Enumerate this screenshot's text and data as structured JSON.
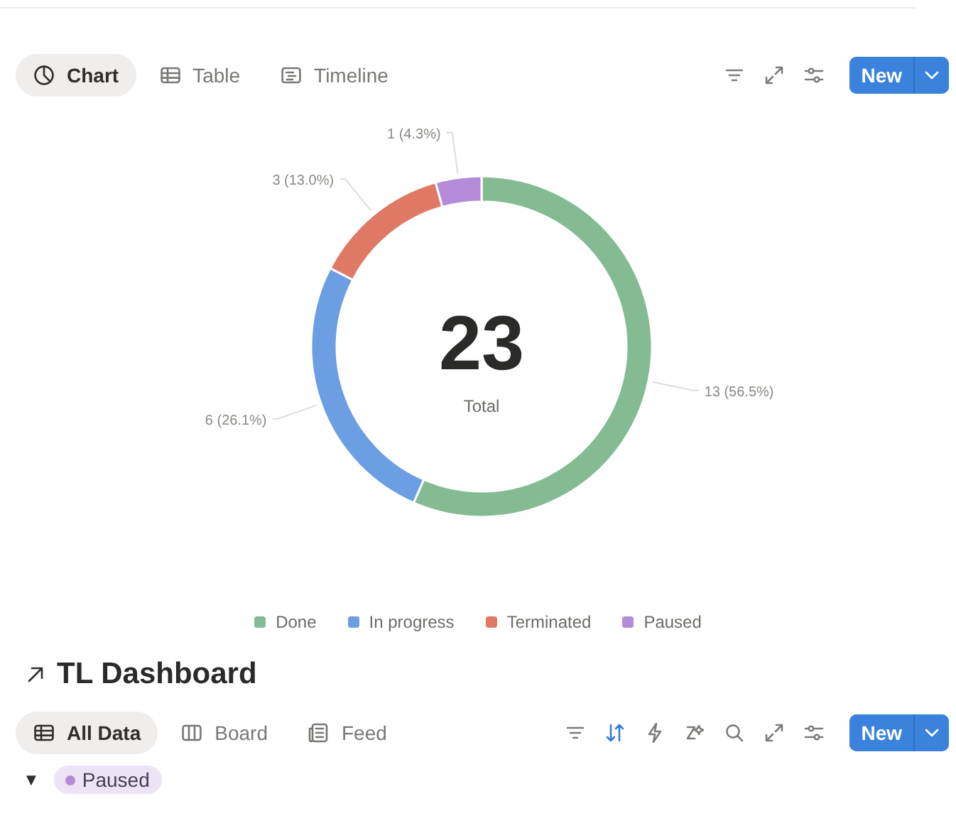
{
  "chart_view": {
    "tabs": [
      {
        "label": "Chart",
        "kind": "chart",
        "selected": true
      },
      {
        "label": "Table",
        "kind": "table",
        "selected": false
      },
      {
        "label": "Timeline",
        "kind": "timeline",
        "selected": false
      }
    ],
    "toolbar_icons": [
      {
        "kind": "filter",
        "active": false
      },
      {
        "kind": "expand",
        "active": false
      },
      {
        "kind": "settings",
        "active": false
      }
    ],
    "new_button": "New",
    "chart": {
      "center_value": "23",
      "center_label": "Total",
      "chart_data": {
        "type": "donut",
        "categories": [
          "Done",
          "In progress",
          "Terminated",
          "Paused"
        ],
        "values": [
          13,
          6,
          3,
          1
        ],
        "value_labels": [
          "13 (56.5%)",
          "6 (26.1%)",
          "3 (13.0%)",
          "1 (4.3%)"
        ]
      },
      "legend": [
        {
          "color": "#84bb93"
        },
        {
          "color": "#6b9ee2"
        },
        {
          "color": "#df7966"
        },
        {
          "color": "#b58ad6"
        }
      ]
    }
  },
  "dashboard": {
    "title": "TL Dashboard",
    "tabs": [
      {
        "label": "All Data",
        "kind": "table",
        "selected": true
      },
      {
        "label": "Board",
        "kind": "board",
        "selected": false
      },
      {
        "label": "Feed",
        "kind": "feed",
        "selected": false
      }
    ],
    "toolbar_icons": [
      {
        "kind": "filter",
        "active": false
      },
      {
        "kind": "sort",
        "active": true
      },
      {
        "kind": "bolt",
        "active": false
      },
      {
        "kind": "sparkle",
        "active": false
      },
      {
        "kind": "search",
        "active": false
      },
      {
        "kind": "expand",
        "active": false
      },
      {
        "kind": "settings",
        "active": false
      }
    ],
    "new_button": "New",
    "group": {
      "toggle": "▼",
      "label": "Paused",
      "color": "#b58ad6"
    }
  }
}
